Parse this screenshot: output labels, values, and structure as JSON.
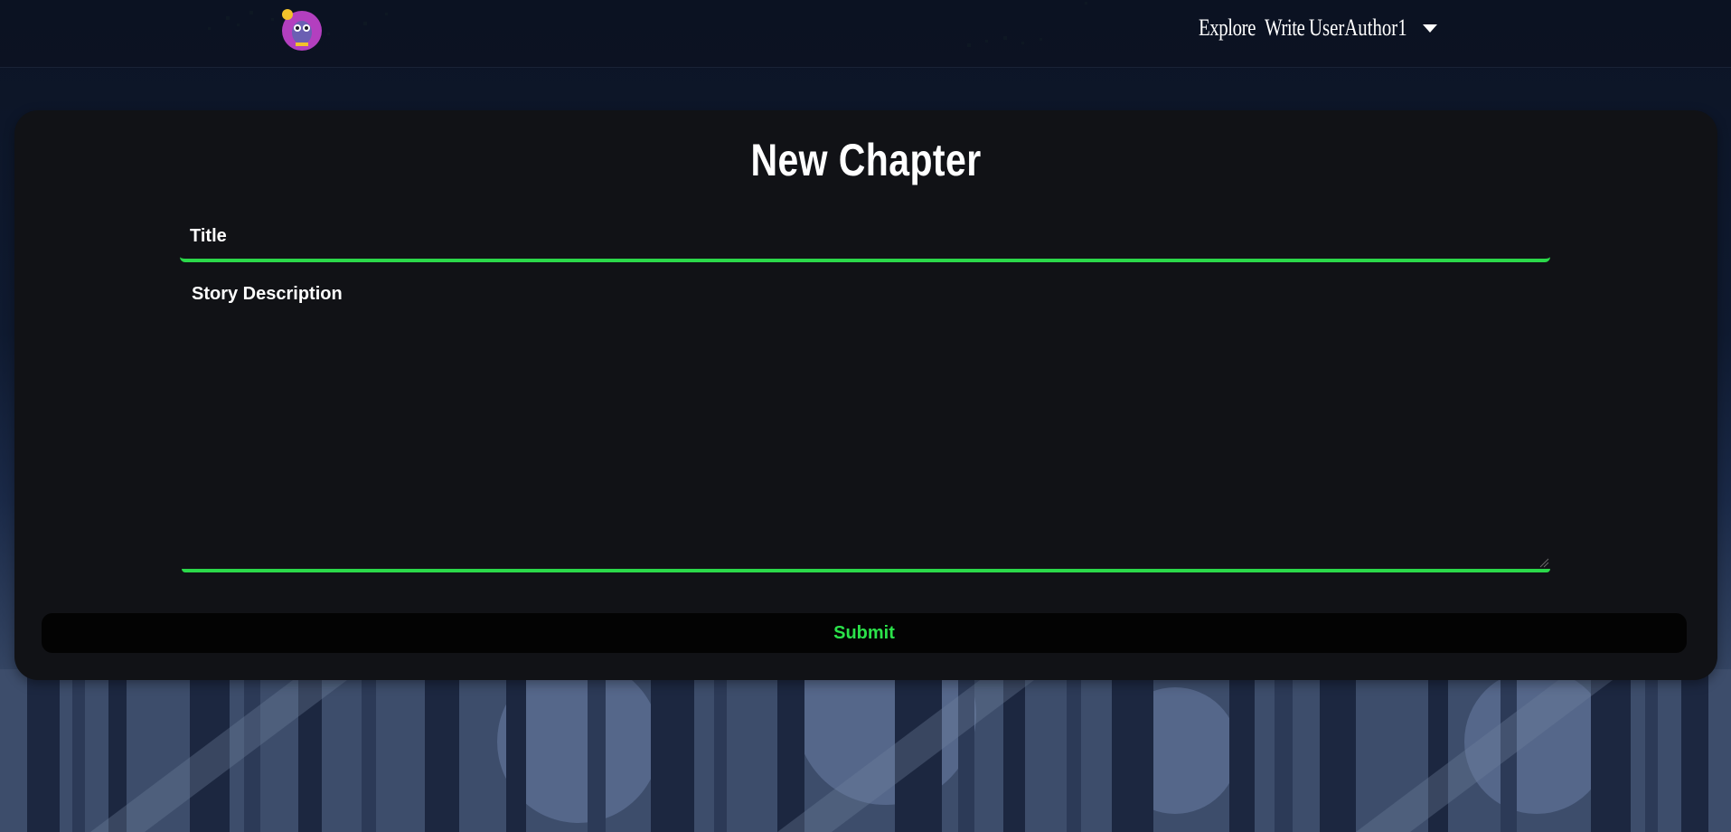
{
  "navbar": {
    "logo_icon": "owl-logo-icon",
    "links": {
      "explore": "Explore",
      "write": "Write"
    },
    "user": {
      "name": "UserAuthor1",
      "dropdown_icon": "caret-down-icon"
    }
  },
  "form": {
    "heading": "New Chapter",
    "title_placeholder": "Title",
    "title_value": "",
    "description_placeholder": "Story Description",
    "description_value": "",
    "submit_label": "Submit"
  },
  "colors": {
    "accent_green": "#2bd84a",
    "card_bg": "#111216",
    "navbar_bg": "#0c1222",
    "submit_bg": "#030303"
  }
}
